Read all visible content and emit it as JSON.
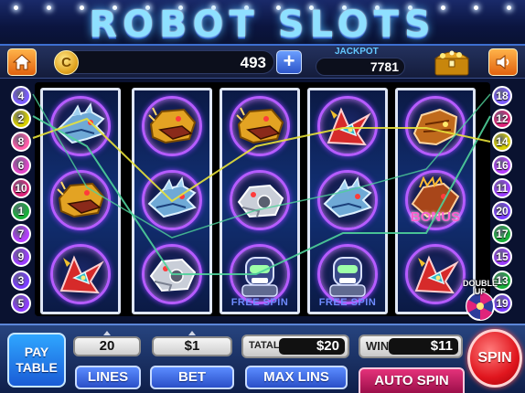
{
  "title": "ROBOT SLOTS",
  "top_bar": {
    "coins": "493",
    "coin_symbol": "C",
    "add_coins_label": "+",
    "jackpot_label": "JACKPOT",
    "jackpot_value": "7781"
  },
  "reels": [
    {
      "symbols": [
        {
          "icon": "blue-dragon-robot-icon",
          "caption": ""
        },
        {
          "icon": "gold-lion-robot-icon",
          "caption": ""
        },
        {
          "icon": "red-bird-robot-icon",
          "caption": ""
        }
      ]
    },
    {
      "symbols": [
        {
          "icon": "gold-lion-robot-icon",
          "caption": ""
        },
        {
          "icon": "blue-dragon-robot-icon",
          "caption": ""
        },
        {
          "icon": "silver-wolf-robot-icon",
          "caption": ""
        }
      ]
    },
    {
      "symbols": [
        {
          "icon": "gold-lion-robot-icon",
          "caption": ""
        },
        {
          "icon": "silver-wolf-robot-icon",
          "caption": ""
        },
        {
          "icon": "robot-head-icon",
          "caption": "FREE SPIN"
        }
      ]
    },
    {
      "symbols": [
        {
          "icon": "red-bird-robot-icon",
          "caption": ""
        },
        {
          "icon": "blue-dragon-robot-icon",
          "caption": ""
        },
        {
          "icon": "robot-head-icon",
          "caption": "FREE SPIN"
        }
      ]
    },
    {
      "symbols": [
        {
          "icon": "orange-scorpion-robot-icon",
          "caption": ""
        },
        {
          "icon": "dino-robot-icon",
          "caption": "BONUS"
        },
        {
          "icon": "red-bird-robot-icon",
          "caption": ""
        }
      ]
    }
  ],
  "left_markers": [
    {
      "num": "4",
      "color": "#7c5cff"
    },
    {
      "num": "2",
      "color": "#d8d000"
    },
    {
      "num": "8",
      "color": "#ff5ca8"
    },
    {
      "num": "6",
      "color": "#e046c8"
    },
    {
      "num": "10",
      "color": "#e0247a"
    },
    {
      "num": "1",
      "color": "#19b03a"
    },
    {
      "num": "7",
      "color": "#b63dff"
    },
    {
      "num": "9",
      "color": "#9c3dff"
    },
    {
      "num": "3",
      "color": "#7a3dff"
    },
    {
      "num": "5",
      "color": "#8f3dff"
    }
  ],
  "right_markers": [
    {
      "num": "18",
      "color": "#7c5cff"
    },
    {
      "num": "12",
      "color": "#e0247a"
    },
    {
      "num": "14",
      "color": "#d8d000"
    },
    {
      "num": "16",
      "color": "#b63dff"
    },
    {
      "num": "11",
      "color": "#9c3dff"
    },
    {
      "num": "20",
      "color": "#7a3dff"
    },
    {
      "num": "17",
      "color": "#19b03a"
    },
    {
      "num": "15",
      "color": "#9c3dff"
    },
    {
      "num": "13",
      "color": "#19b03a"
    },
    {
      "num": "19",
      "color": "#7a3dff"
    }
  ],
  "double_up": "DOUBLE UP",
  "controls": {
    "pay_table": "PAY\nTABLE",
    "lines_value": "20",
    "lines_label": "LINES",
    "bet_value": "$1",
    "bet_label": "BET",
    "total_label": "TATAL",
    "total_value": "$20",
    "max_lines_label": "MAX LINS",
    "win_label": "WIN",
    "win_value": "$11",
    "auto_spin_label": "AUTO SPIN",
    "spin_label": "SPIN"
  },
  "colors": {
    "payline_green": "#4fd19a",
    "payline_yellow": "#e8e23a",
    "symbol_ring": "#b65cff"
  }
}
